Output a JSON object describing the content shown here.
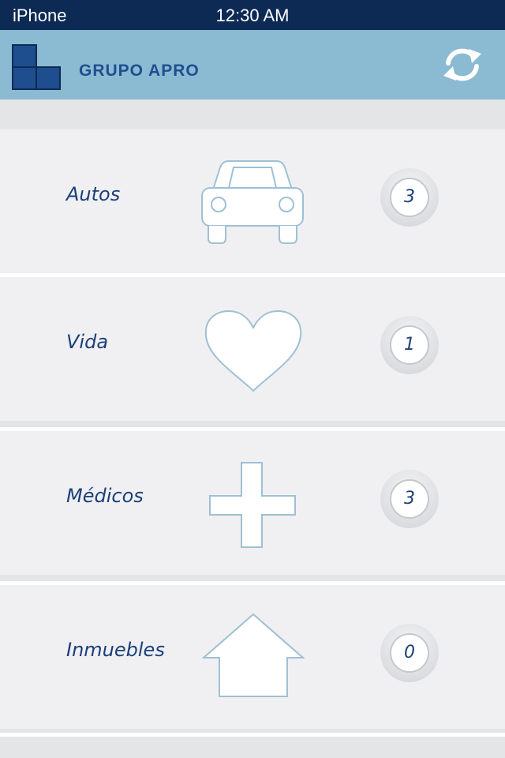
{
  "status_bar": {
    "carrier": "iPhone",
    "time": "12:30 AM"
  },
  "header": {
    "brand": "GRUPO APRO",
    "refresh_icon": "refresh-icon"
  },
  "colors": {
    "header_bg": "#8bbad3",
    "status_bg": "#0d2a55",
    "text": "#1b3f7a",
    "icon_stroke": "#9fc0d4"
  },
  "categories": [
    {
      "label": "Autos",
      "icon": "car-icon",
      "count": "3"
    },
    {
      "label": "Vida",
      "icon": "heart-icon",
      "count": "1"
    },
    {
      "label": "Médicos",
      "icon": "cross-icon",
      "count": "3"
    },
    {
      "label": "Inmuebles",
      "icon": "house-icon",
      "count": "0"
    }
  ]
}
